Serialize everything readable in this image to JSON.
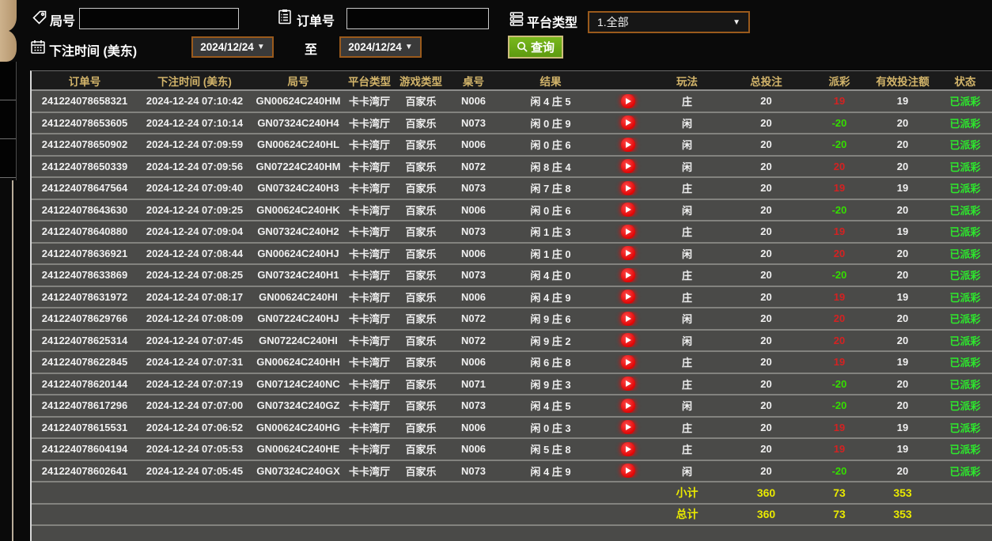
{
  "filters": {
    "round_label": "局号",
    "round_input_value": "",
    "order_label": "订单号",
    "order_input_value": "",
    "platform_label": "平台类型",
    "platform_value": "1.全部",
    "bet_time_label": "下注时间 (美东)",
    "date_from": "2024/12/24",
    "to_label": "至",
    "date_to": "2024/12/24",
    "query_label": "查询"
  },
  "colors": {
    "header_gold": "#d2b46a",
    "payout_win_red": "#d42222",
    "payout_loss_green": "#35dd00",
    "status_green": "#2de82d",
    "totals_yellow": "#e9e900",
    "query_button_green": "#66a716",
    "select_border_orange": "#9a5a1c"
  },
  "table": {
    "headers": [
      "订单号",
      "下注时间 (美东)",
      "局号",
      "平台类型",
      "游戏类型",
      "桌号",
      "结果",
      "",
      "玩法",
      "总投注",
      "派彩",
      "有效投注额",
      "状态"
    ],
    "rows": [
      {
        "order": "241224078658321",
        "time": "2024-12-24 07:10:42",
        "round": "GN00624C240HM",
        "platform": "卡卡湾厅",
        "game": "百家乐",
        "table_no": "N006",
        "result": "闲 4 庄 5",
        "play": "庄",
        "bet": "20",
        "payout": "19",
        "payout_sign": "win",
        "valid": "19",
        "status": "已派彩"
      },
      {
        "order": "241224078653605",
        "time": "2024-12-24 07:10:14",
        "round": "GN07324C240H4",
        "platform": "卡卡湾厅",
        "game": "百家乐",
        "table_no": "N073",
        "result": "闲 0 庄 9",
        "play": "闲",
        "bet": "20",
        "payout": "-20",
        "payout_sign": "loss",
        "valid": "20",
        "status": "已派彩"
      },
      {
        "order": "241224078650902",
        "time": "2024-12-24 07:09:59",
        "round": "GN00624C240HL",
        "platform": "卡卡湾厅",
        "game": "百家乐",
        "table_no": "N006",
        "result": "闲 0 庄 6",
        "play": "闲",
        "bet": "20",
        "payout": "-20",
        "payout_sign": "loss",
        "valid": "20",
        "status": "已派彩"
      },
      {
        "order": "241224078650339",
        "time": "2024-12-24 07:09:56",
        "round": "GN07224C240HM",
        "platform": "卡卡湾厅",
        "game": "百家乐",
        "table_no": "N072",
        "result": "闲 8 庄 4",
        "play": "闲",
        "bet": "20",
        "payout": "20",
        "payout_sign": "win",
        "valid": "20",
        "status": "已派彩"
      },
      {
        "order": "241224078647564",
        "time": "2024-12-24 07:09:40",
        "round": "GN07324C240H3",
        "platform": "卡卡湾厅",
        "game": "百家乐",
        "table_no": "N073",
        "result": "闲 7 庄 8",
        "play": "庄",
        "bet": "20",
        "payout": "19",
        "payout_sign": "win",
        "valid": "19",
        "status": "已派彩"
      },
      {
        "order": "241224078643630",
        "time": "2024-12-24 07:09:25",
        "round": "GN00624C240HK",
        "platform": "卡卡湾厅",
        "game": "百家乐",
        "table_no": "N006",
        "result": "闲 0 庄 6",
        "play": "闲",
        "bet": "20",
        "payout": "-20",
        "payout_sign": "loss",
        "valid": "20",
        "status": "已派彩"
      },
      {
        "order": "241224078640880",
        "time": "2024-12-24 07:09:04",
        "round": "GN07324C240H2",
        "platform": "卡卡湾厅",
        "game": "百家乐",
        "table_no": "N073",
        "result": "闲 1 庄 3",
        "play": "庄",
        "bet": "20",
        "payout": "19",
        "payout_sign": "win",
        "valid": "19",
        "status": "已派彩"
      },
      {
        "order": "241224078636921",
        "time": "2024-12-24 07:08:44",
        "round": "GN00624C240HJ",
        "platform": "卡卡湾厅",
        "game": "百家乐",
        "table_no": "N006",
        "result": "闲 1 庄 0",
        "play": "闲",
        "bet": "20",
        "payout": "20",
        "payout_sign": "win",
        "valid": "20",
        "status": "已派彩"
      },
      {
        "order": "241224078633869",
        "time": "2024-12-24 07:08:25",
        "round": "GN07324C240H1",
        "platform": "卡卡湾厅",
        "game": "百家乐",
        "table_no": "N073",
        "result": "闲 4 庄 0",
        "play": "庄",
        "bet": "20",
        "payout": "-20",
        "payout_sign": "loss",
        "valid": "20",
        "status": "已派彩"
      },
      {
        "order": "241224078631972",
        "time": "2024-12-24 07:08:17",
        "round": "GN00624C240HI",
        "platform": "卡卡湾厅",
        "game": "百家乐",
        "table_no": "N006",
        "result": "闲 4 庄 9",
        "play": "庄",
        "bet": "20",
        "payout": "19",
        "payout_sign": "win",
        "valid": "19",
        "status": "已派彩"
      },
      {
        "order": "241224078629766",
        "time": "2024-12-24 07:08:09",
        "round": "GN07224C240HJ",
        "platform": "卡卡湾厅",
        "game": "百家乐",
        "table_no": "N072",
        "result": "闲 9 庄 6",
        "play": "闲",
        "bet": "20",
        "payout": "20",
        "payout_sign": "win",
        "valid": "20",
        "status": "已派彩"
      },
      {
        "order": "241224078625314",
        "time": "2024-12-24 07:07:45",
        "round": "GN07224C240HI",
        "platform": "卡卡湾厅",
        "game": "百家乐",
        "table_no": "N072",
        "result": "闲 9 庄 2",
        "play": "闲",
        "bet": "20",
        "payout": "20",
        "payout_sign": "win",
        "valid": "20",
        "status": "已派彩"
      },
      {
        "order": "241224078622845",
        "time": "2024-12-24 07:07:31",
        "round": "GN00624C240HH",
        "platform": "卡卡湾厅",
        "game": "百家乐",
        "table_no": "N006",
        "result": "闲 6 庄 8",
        "play": "庄",
        "bet": "20",
        "payout": "19",
        "payout_sign": "win",
        "valid": "19",
        "status": "已派彩"
      },
      {
        "order": "241224078620144",
        "time": "2024-12-24 07:07:19",
        "round": "GN07124C240NC",
        "platform": "卡卡湾厅",
        "game": "百家乐",
        "table_no": "N071",
        "result": "闲 9 庄 3",
        "play": "庄",
        "bet": "20",
        "payout": "-20",
        "payout_sign": "loss",
        "valid": "20",
        "status": "已派彩"
      },
      {
        "order": "241224078617296",
        "time": "2024-12-24 07:07:00",
        "round": "GN07324C240GZ",
        "platform": "卡卡湾厅",
        "game": "百家乐",
        "table_no": "N073",
        "result": "闲 4 庄 5",
        "play": "闲",
        "bet": "20",
        "payout": "-20",
        "payout_sign": "loss",
        "valid": "20",
        "status": "已派彩"
      },
      {
        "order": "241224078615531",
        "time": "2024-12-24 07:06:52",
        "round": "GN00624C240HG",
        "platform": "卡卡湾厅",
        "game": "百家乐",
        "table_no": "N006",
        "result": "闲 0 庄 3",
        "play": "庄",
        "bet": "20",
        "payout": "19",
        "payout_sign": "win",
        "valid": "19",
        "status": "已派彩"
      },
      {
        "order": "241224078604194",
        "time": "2024-12-24 07:05:53",
        "round": "GN00624C240HE",
        "platform": "卡卡湾厅",
        "game": "百家乐",
        "table_no": "N006",
        "result": "闲 5 庄 8",
        "play": "庄",
        "bet": "20",
        "payout": "19",
        "payout_sign": "win",
        "valid": "19",
        "status": "已派彩"
      },
      {
        "order": "241224078602641",
        "time": "2024-12-24 07:05:45",
        "round": "GN07324C240GX",
        "platform": "卡卡湾厅",
        "game": "百家乐",
        "table_no": "N073",
        "result": "闲 4 庄 9",
        "play": "闲",
        "bet": "20",
        "payout": "-20",
        "payout_sign": "loss",
        "valid": "20",
        "status": "已派彩"
      }
    ],
    "subtotal": {
      "label": "小计",
      "bet": "360",
      "payout": "73",
      "valid": "353"
    },
    "grand_total": {
      "label": "总计",
      "bet": "360",
      "payout": "73",
      "valid": "353"
    }
  }
}
